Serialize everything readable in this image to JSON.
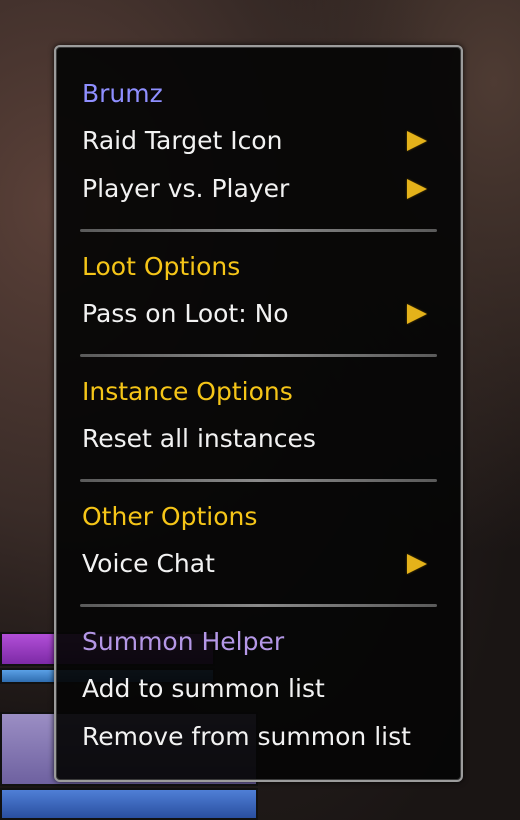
{
  "menu": {
    "unit_name": "Brumz",
    "sections": [
      {
        "items": [
          {
            "label": "Raid Target Icon",
            "submenu": true
          },
          {
            "label": "Player vs. Player",
            "submenu": true
          }
        ]
      },
      {
        "header": "Loot Options",
        "items": [
          {
            "label": "Pass on Loot: No",
            "submenu": true
          }
        ]
      },
      {
        "header": "Instance Options",
        "items": [
          {
            "label": "Reset all instances",
            "submenu": false
          }
        ]
      },
      {
        "header": "Other Options",
        "items": [
          {
            "label": "Voice Chat",
            "submenu": true
          }
        ]
      },
      {
        "header": "Summon Helper",
        "items": [
          {
            "label": "Add to summon list",
            "submenu": false
          },
          {
            "label": "Remove from summon list",
            "submenu": false
          }
        ]
      }
    ]
  },
  "colors": {
    "unit_name": "#8f8fff",
    "section_header": "#f5c518",
    "addon_header": "#b497e6",
    "item_text": "#f2f2f2",
    "submenu_arrow": "#e4b21a"
  },
  "icons": {
    "submenu": "submenu-arrow-icon"
  }
}
